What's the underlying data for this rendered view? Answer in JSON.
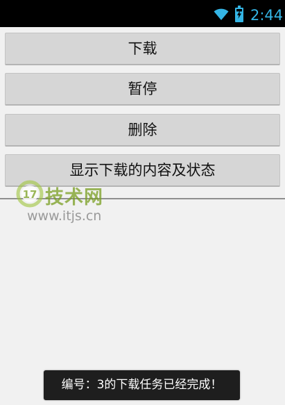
{
  "status_bar": {
    "time": "2:44",
    "icons": [
      "wifi-icon",
      "battery-charging-icon"
    ],
    "accent_color": "#34b5e5"
  },
  "buttons": [
    {
      "label": "下载"
    },
    {
      "label": "暂停"
    },
    {
      "label": "删除"
    },
    {
      "label": "显示下载的内容及状态"
    }
  ],
  "watermark": {
    "brand": "技术网",
    "url": "www.itjs.cn",
    "logo_text": "17"
  },
  "toast": {
    "message": "编号：3的下载任务已经完成！"
  },
  "colors": {
    "background": "#f1f1f1",
    "button": "#d6d6d6",
    "toast": "#1e1e1e"
  }
}
